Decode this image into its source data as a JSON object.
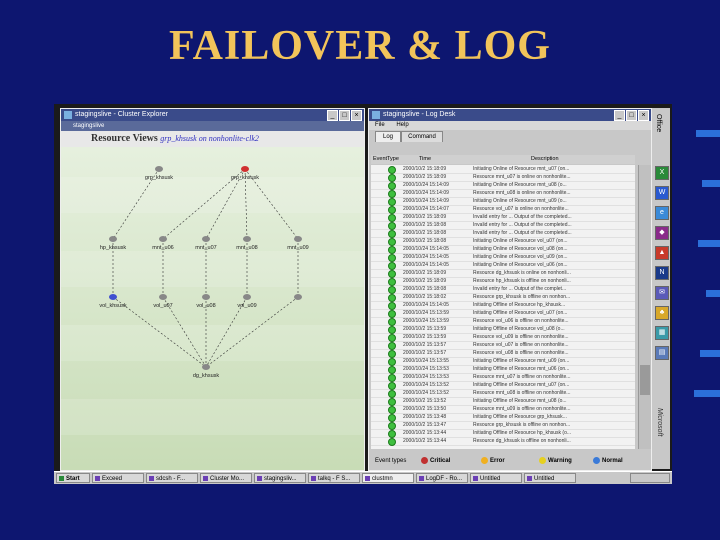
{
  "slide": {
    "title": "FAILOVER & LOG"
  },
  "cluster_window": {
    "title": "stagingslive - Cluster Explorer",
    "subtitle": "stagingslive",
    "header": "Resource Views",
    "header_sub": "grp_khsusk on nonhonlite-clk2",
    "nodes": [
      {
        "label": "grp_khsusk"
      },
      {
        "label": "grp_khsusk"
      },
      {
        "label": "hp_khsusk"
      },
      {
        "label": "mnt_u06"
      },
      {
        "label": "mnt_u07"
      },
      {
        "label": "mnt_u08"
      },
      {
        "label": "mnt_u09"
      },
      {
        "label": "vol_khsusk"
      },
      {
        "label": "vol_u07"
      },
      {
        "label": "vol_u08"
      },
      {
        "label": "vol_u09"
      },
      {
        "label": "dg_khsusk"
      }
    ]
  },
  "log_window": {
    "title": "stagingslive - Log Desk",
    "menu": [
      "File",
      "Help"
    ],
    "tabs": [
      "Log",
      "Command"
    ],
    "columns": [
      "Event",
      "Type",
      "Time",
      "Description"
    ],
    "rows": [
      {
        "time": "2000/10/2 15:18:09",
        "desc": "Initiating Online of Resource mnt_u07 (on..."
      },
      {
        "time": "2000/10/2 15:18:09",
        "desc": "Resource mnt_u07 is online on nonhonlite..."
      },
      {
        "time": "2000/10/24 15:14:09",
        "desc": "Initiating Online of Resource mnt_u08 (o..."
      },
      {
        "time": "2000/10/24 15:14:09",
        "desc": "Resource mnt_u08 is online on nonhonlite..."
      },
      {
        "time": "2000/10/24 15:14:09",
        "desc": "Initiating Online of Resource mnt_u09 (o..."
      },
      {
        "time": "2000/10/24 15:14:07",
        "desc": "Resource vol_u07 is online on nonhonlite..."
      },
      {
        "time": "2000/10/2 15:18:09",
        "desc": "Invalid entry for ... Output of the completed..."
      },
      {
        "time": "2000/10/2 15:18:08",
        "desc": "Invalid entry for ... Output of the completed..."
      },
      {
        "time": "2000/10/2 15:18:08",
        "desc": "Invalid entry for ... Output of the completed..."
      },
      {
        "time": "2000/10/2 15:18:08",
        "desc": "Initiating Online of Resource vol_u07 (on..."
      },
      {
        "time": "2000/10/24 15:14:05",
        "desc": "Initiating Online of Resource vol_u08 (on..."
      },
      {
        "time": "2000/10/24 15:14:05",
        "desc": "Initiating Online of Resource vol_u09 (on..."
      },
      {
        "time": "2000/10/24 15:14:05",
        "desc": "Initiating Online of Resource vol_u06 (on..."
      },
      {
        "time": "2000/10/2 15:18:09",
        "desc": "Resource dg_khsusk is online on nonhonli..."
      },
      {
        "time": "2000/10/2 15:18:09",
        "desc": "Resource hp_khsusk is offline on nonhonli..."
      },
      {
        "time": "2000/10/2 15:18:08",
        "desc": "Invalid entry for ... Output of the complet..."
      },
      {
        "time": "2000/10/2 15:18:02",
        "desc": "Resource grp_khsusk is offline on nonhon..."
      },
      {
        "time": "2000/10/24 15:14:05",
        "desc": "Initiating Offline of Resource hp_khsusk..."
      },
      {
        "time": "2000/10/24 15:13:59",
        "desc": "Initiating Offline of Resource vol_u07 (on..."
      },
      {
        "time": "2000/10/24 15:13:59",
        "desc": "Resource vol_u06 is offline on nonhonlite..."
      },
      {
        "time": "2000/10/2 15:13:59",
        "desc": "Initiating Offline of Resource vol_u08 (o..."
      },
      {
        "time": "2000/10/2 15:13:59",
        "desc": "Resource vol_u09 is offline on nonhonlite..."
      },
      {
        "time": "2000/10/2 15:13:57",
        "desc": "Resource vol_u07 is offline on nonhonlite..."
      },
      {
        "time": "2000/10/2 15:13:57",
        "desc": "Resource vol_u08 is offline on nonhonlite..."
      },
      {
        "time": "2000/10/24 15:13:55",
        "desc": "Initiating Offline of Resource mnt_u09 (on..."
      },
      {
        "time": "2000/10/24 15:13:53",
        "desc": "Initiating Offline of Resource mnt_u06 (on..."
      },
      {
        "time": "2000/10/24 15:13:53",
        "desc": "Resource mnt_u07 is offline on nonhonlite..."
      },
      {
        "time": "2000/10/24 15:13:52",
        "desc": "Initiating Offline of Resource mnt_u07 (on..."
      },
      {
        "time": "2000/10/24 15:13:52",
        "desc": "Resource mnt_u08 is offline on nonhonlite..."
      },
      {
        "time": "2000/10/2 15:13:52",
        "desc": "Initiating Offline of Resource mnt_u08 (o..."
      },
      {
        "time": "2000/10/2 15:13:50",
        "desc": "Resource mnt_u09 is offline on nonhonlite..."
      },
      {
        "time": "2000/10/2 15:13:48",
        "desc": "Initiating Offline of Resource grp_khsusk..."
      },
      {
        "time": "2000/10/2 15:13:47",
        "desc": "Resource grp_khsusk is offline on nonhon..."
      },
      {
        "time": "2000/10/2 15:13:44",
        "desc": "Initiating Offline of Resource hp_khsusk (o..."
      },
      {
        "time": "2000/10/2 15:13:44",
        "desc": "Resource dg_khsusk is offline on nonhonli..."
      }
    ],
    "filter": {
      "label": "Event types",
      "items": [
        "Critical",
        "Error",
        "Warning",
        "Normal"
      ],
      "colors": [
        "#c03030",
        "#f0b020",
        "#e6d020",
        "#3a7ad8"
      ]
    }
  },
  "office_bar": {
    "title": "Office",
    "vendor": "Microsoft"
  },
  "taskbar": {
    "items": [
      "Start",
      "Exceed",
      "sdcsh - F...",
      "Cluster Mo...",
      "stagingsliv...",
      "talkq - F S...",
      "clustmn",
      "LogDF - Ro...",
      "Untitled",
      "Untitled"
    ]
  }
}
